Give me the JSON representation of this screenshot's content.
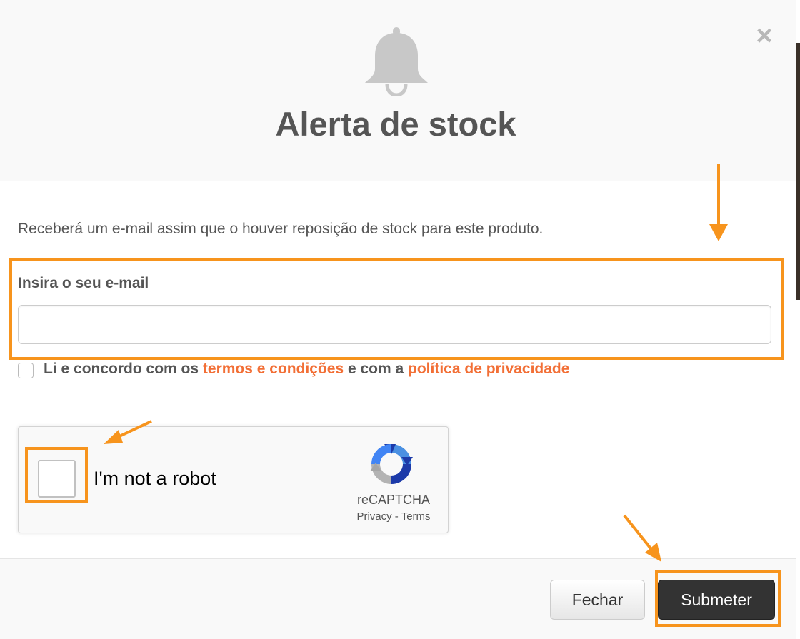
{
  "modal": {
    "title": "Alerta de stock",
    "close_symbol": "×",
    "description": "Receberá um e-mail assim que o houver reposição de stock para este produto.",
    "email_label": "Insira o seu e-mail",
    "email_value": "",
    "email_placeholder": "",
    "terms": {
      "prefix": "Li e concordo com os",
      "terms_link": "termos e condições",
      "middle": "e com a",
      "privacy_link": "política de privacidade",
      "checked": false
    },
    "recaptcha": {
      "label": "I'm not a robot",
      "brand": "reCAPTCHA",
      "privacy": "Privacy",
      "separator": "-",
      "terms": "Terms"
    },
    "buttons": {
      "close": "Fechar",
      "submit": "Submeter"
    }
  },
  "colors": {
    "accent_link": "#f26f36",
    "highlight": "#f7941d",
    "submit_bg": "#333333",
    "text": "#555555"
  },
  "icons": [
    "bell-icon",
    "close-icon",
    "recaptcha-logo-icon"
  ]
}
